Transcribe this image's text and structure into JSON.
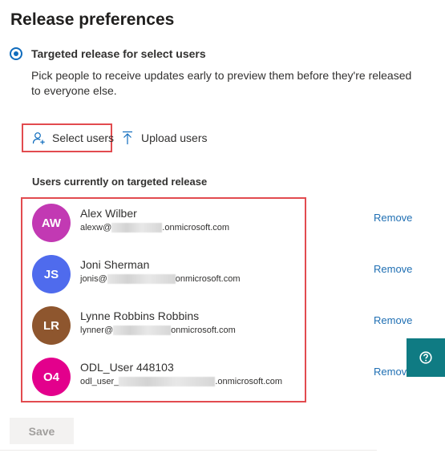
{
  "page": {
    "title": "Release preferences"
  },
  "targeted_option": {
    "label": "Targeted release for select users",
    "selected": true,
    "description": "Pick people to receive updates early to preview them before they're released to everyone else."
  },
  "actions": {
    "select_users": {
      "label": "Select users",
      "icon": "add-person-icon"
    },
    "upload_users": {
      "label": "Upload users",
      "icon": "upload-arrow-icon"
    }
  },
  "users_section": {
    "heading": "Users currently on targeted release",
    "remove_label": "Remove",
    "users": [
      {
        "initials": "AW",
        "name": "Alex Wilber",
        "email_prefix": "alexw@",
        "email_suffix": ".onmicrosoft.com",
        "avatar_color": "#c239b3"
      },
      {
        "initials": "JS",
        "name": "Joni Sherman",
        "email_prefix": "jonis@",
        "email_suffix": "onmicrosoft.com",
        "avatar_color": "#4f6bed"
      },
      {
        "initials": "LR",
        "name": "Lynne Robbins Robbins",
        "email_prefix": "lynner@",
        "email_suffix": "onmicrosoft.com",
        "avatar_color": "#8e562e"
      },
      {
        "initials": "O4",
        "name": "ODL_User 448103",
        "email_prefix": "odl_user_",
        "email_suffix": ".onmicrosoft.com",
        "avatar_color": "#e3008c"
      }
    ]
  },
  "footer": {
    "save_label": "Save",
    "save_enabled": false
  },
  "help_button": {
    "icon": "question-mark-icon",
    "color": "#0f7b83"
  },
  "colors": {
    "accent": "#0f6cbd",
    "link": "#1f6fb3",
    "highlight_border": "#e24b4f"
  }
}
